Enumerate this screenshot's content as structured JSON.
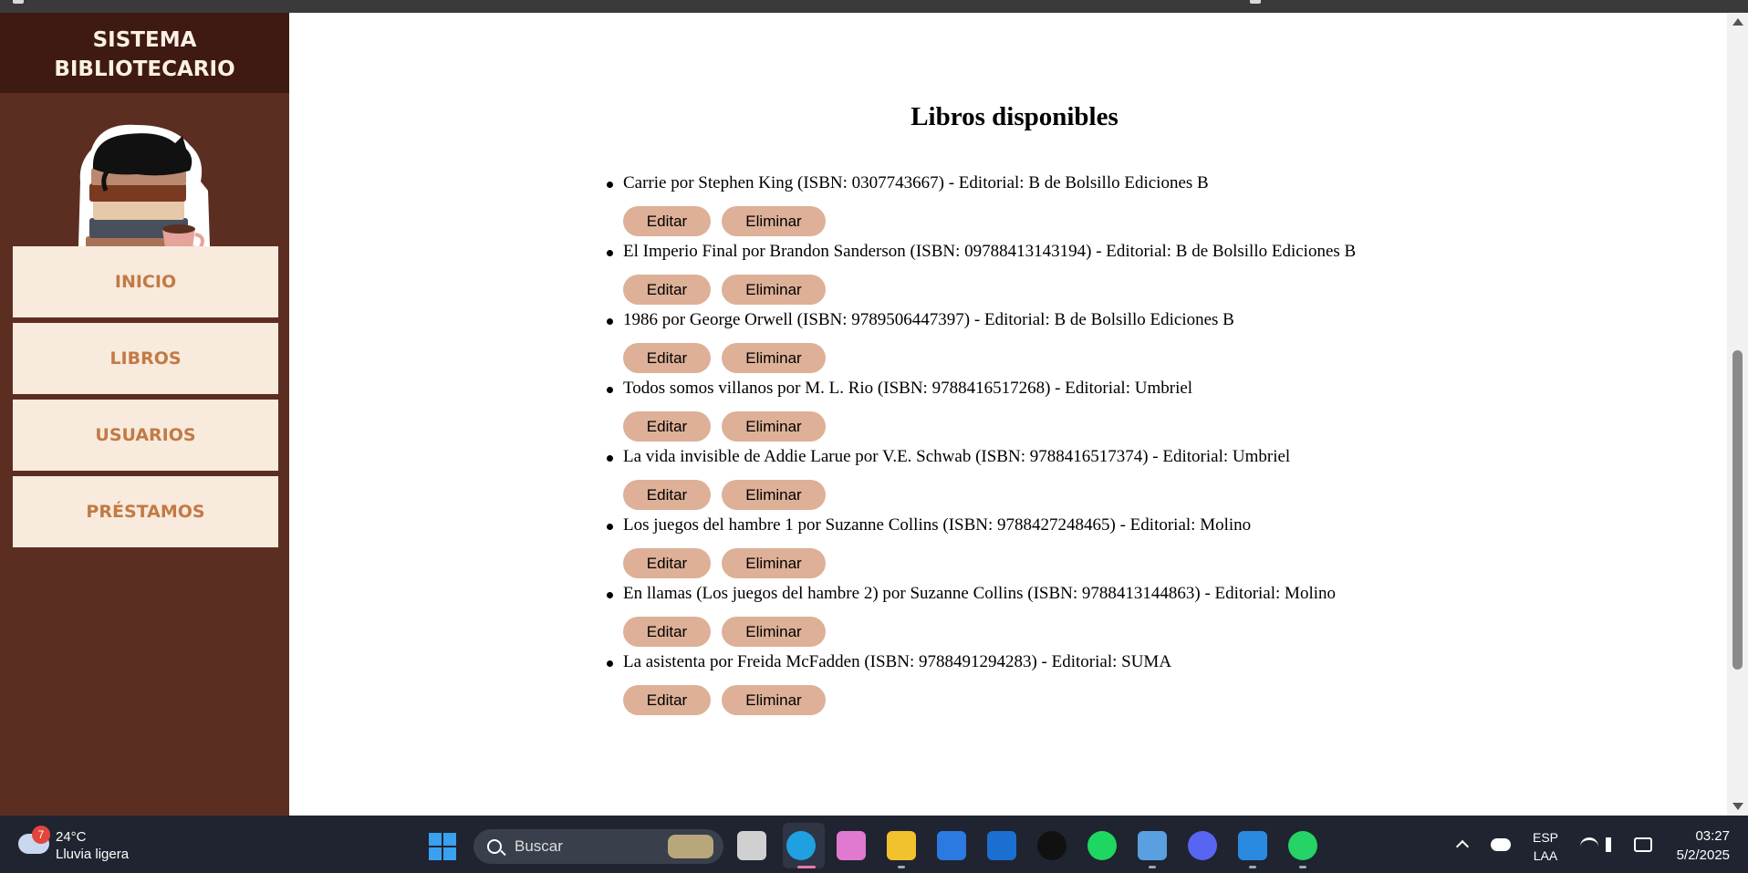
{
  "sidebar": {
    "title_line1": "SISTEMA",
    "title_line2": "BIBLIOTECARIO",
    "nav": [
      {
        "label": "INICIO"
      },
      {
        "label": "LIBROS"
      },
      {
        "label": "USUARIOS"
      },
      {
        "label": "PRÉSTAMOS"
      }
    ]
  },
  "main": {
    "title": "Libros disponibles",
    "edit_label": "Editar",
    "delete_label": "Eliminar",
    "books": [
      {
        "text": "Carrie por Stephen King (ISBN: 0307743667) - Editorial: B de Bolsillo Ediciones B"
      },
      {
        "text": "El Imperio Final por Brandon Sanderson (ISBN: 09788413143194) - Editorial: B de Bolsillo Ediciones B"
      },
      {
        "text": "1986 por George Orwell (ISBN: 9789506447397) - Editorial: B de Bolsillo Ediciones B"
      },
      {
        "text": "Todos somos villanos por M. L. Rio (ISBN: 9788416517268) - Editorial: Umbriel"
      },
      {
        "text": "La vida invisible de Addie Larue por V.E. Schwab (ISBN: 9788416517374) - Editorial: Umbriel"
      },
      {
        "text": "Los juegos del hambre 1 por Suzanne Collins (ISBN: 9788427248465) - Editorial: Molino"
      },
      {
        "text": "En llamas (Los juegos del hambre 2) por Suzanne Collins (ISBN: 9788413144863) - Editorial: Molino"
      },
      {
        "text": "La asistenta por Freida McFadden (ISBN: 9788491294283) - Editorial: SUMA"
      }
    ]
  },
  "taskbar": {
    "weather_badge": "7",
    "weather_temp": "24°C",
    "weather_desc": "Lluvia ligera",
    "search_placeholder": "Buscar",
    "lang_line1": "ESP",
    "lang_line2": "LAA",
    "time": "03:27",
    "date": "5/2/2025",
    "apps": [
      {
        "icon": "task-view-icon",
        "color": "#d0d0d0"
      },
      {
        "icon": "edge-icon",
        "color": "#1fa0e0"
      },
      {
        "icon": "copilot-icon",
        "color": "#e07ad0"
      },
      {
        "icon": "file-explorer-icon",
        "color": "#f2c12e"
      },
      {
        "icon": "microsoft-store-icon",
        "color": "#2a7ae2"
      },
      {
        "icon": "outlook-icon",
        "color": "#1a6fd0"
      },
      {
        "icon": "tiktok-icon",
        "color": "#111111"
      },
      {
        "icon": "spotify-icon",
        "color": "#1ed760"
      },
      {
        "icon": "photos-icon",
        "color": "#5aa0e0"
      },
      {
        "icon": "discord-icon",
        "color": "#5865f2"
      },
      {
        "icon": "vscode-icon",
        "color": "#2a8ae0"
      },
      {
        "icon": "whatsapp-icon",
        "color": "#25d366"
      }
    ]
  },
  "colors": {
    "sidebar_bg": "#5c2e22",
    "sidebar_header_bg": "#3e1a12",
    "nav_bg": "#f8eadd",
    "nav_text": "#c27a45",
    "button_bg": "#ddb097"
  }
}
